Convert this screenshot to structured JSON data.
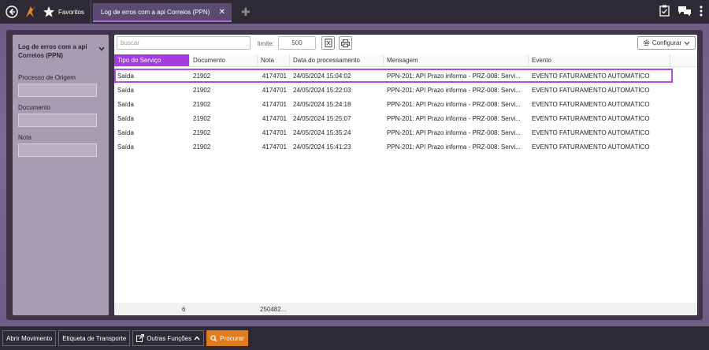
{
  "topbar": {
    "favorites_label": "Favoritos",
    "tab_label": "Log de erros com a api Correios (PPN)",
    "icons": [
      "back-icon",
      "logo-icon",
      "star-icon",
      "close-icon",
      "add-icon",
      "clipboard-icon",
      "chat-icon",
      "menu-dots-icon"
    ]
  },
  "filter": {
    "title": "Log de erros com a api Correios (PPN)",
    "fields": [
      {
        "label": "Processo de Origem",
        "value": ""
      },
      {
        "label": "Documento",
        "value": ""
      },
      {
        "label": "Nota",
        "value": ""
      }
    ]
  },
  "toolbar": {
    "search_placeholder": "buscar",
    "limit_label": "limite:",
    "limit_value": "500",
    "configure_label": "Configurar"
  },
  "table": {
    "columns": [
      "Tipo do Serviço",
      "Documento",
      "Nota",
      "Data do processamento",
      "Mensagem",
      "Evento"
    ],
    "rows": [
      [
        "Saída",
        "21902",
        "4174701",
        "24/05/2024 15:04:02",
        "PPN-201: API Prazo informa - PRZ-008: Servi...",
        "EVENTO FATURAMENTO AUTOMÁTICO"
      ],
      [
        "Saída",
        "21902",
        "4174701",
        "24/05/2024 15:22:03",
        "PPN-201: API Prazo informa - PRZ-008: Servi...",
        "EVENTO FATURAMENTO AUTOMÁTICO"
      ],
      [
        "Saída",
        "21902",
        "4174701",
        "24/05/2024 15:24:18",
        "PPN-201: API Prazo informa - PRZ-008: Servi...",
        "EVENTO FATURAMENTO AUTOMÁTICO"
      ],
      [
        "Saída",
        "21902",
        "4174701",
        "24/05/2024 15:25:07",
        "PPN-201: API Prazo informa - PRZ-008: Servi...",
        "EVENTO FATURAMENTO AUTOMÁTICO"
      ],
      [
        "Saída",
        "21902",
        "4174701",
        "24/05/2024 15:35:24",
        "PPN-201: API Prazo informa - PRZ-008: Servi...",
        "EVENTO FATURAMENTO AUTOMÁTICO"
      ],
      [
        "Saída",
        "21902",
        "4174701",
        "24/05/2024 15:41:23",
        "PPN-201: API Prazo informa - PRZ-008: Servi...",
        "EVENTO FATURAMENTO AUTOMÁTICO"
      ]
    ],
    "footer_count": "6",
    "footer_sum": "250482..."
  },
  "bottombar": {
    "buttons": [
      "Abrir Movimento",
      "Etiqueta de Transporte",
      "Outras Funções",
      "Procurar"
    ]
  },
  "colors": {
    "accent": "#a43de0",
    "primary_button": "#e07b1e",
    "topbar": "#2e2a35"
  }
}
